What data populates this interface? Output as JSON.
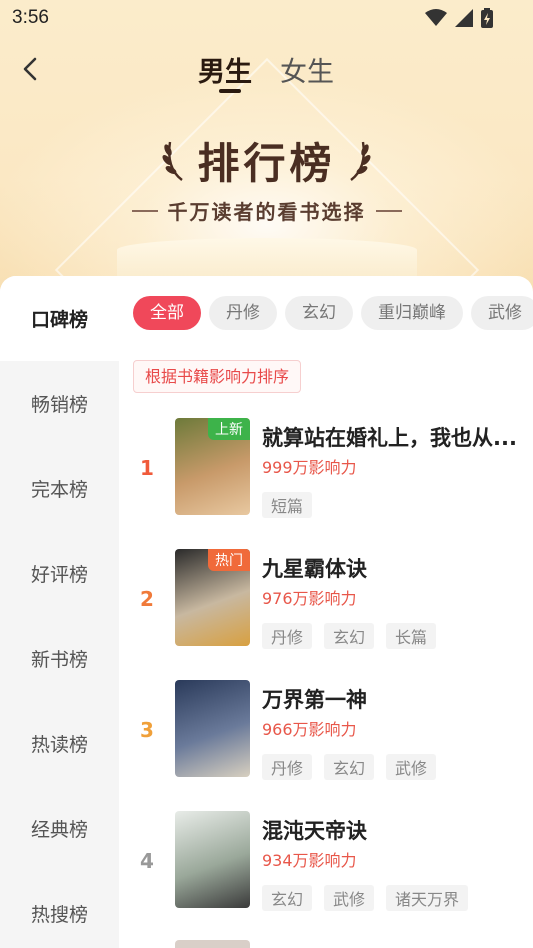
{
  "status_bar": {
    "time": "3:56"
  },
  "header": {
    "back_icon": "chevron-left-icon",
    "tabs": [
      {
        "label": "男生",
        "active": true
      },
      {
        "label": "女生",
        "active": false
      }
    ]
  },
  "hero": {
    "title": "排行榜",
    "subtitle": "千万读者的看书选择"
  },
  "sidebar": {
    "items": [
      {
        "label": "口碑榜",
        "active": true
      },
      {
        "label": "畅销榜",
        "active": false
      },
      {
        "label": "完本榜",
        "active": false
      },
      {
        "label": "好评榜",
        "active": false
      },
      {
        "label": "新书榜",
        "active": false
      },
      {
        "label": "热读榜",
        "active": false
      },
      {
        "label": "经典榜",
        "active": false
      },
      {
        "label": "热搜榜",
        "active": false
      }
    ]
  },
  "filters": {
    "chips": [
      {
        "label": "全部",
        "active": true
      },
      {
        "label": "丹修",
        "active": false
      },
      {
        "label": "玄幻",
        "active": false
      },
      {
        "label": "重归巅峰",
        "active": false
      },
      {
        "label": "武修",
        "active": false
      }
    ]
  },
  "sort_note": "根据书籍影响力排序",
  "books": [
    {
      "rank": "1",
      "rank_color": "#f05a3a",
      "title": "就算站在婚礼上，我也从...",
      "heat": "999万影响力",
      "badge": "上新",
      "badge_color": "#3db34a",
      "tags": [
        "短篇"
      ],
      "cover_colors": [
        "#6d7a3a",
        "#c89a6a",
        "#e8c8a0"
      ]
    },
    {
      "rank": "2",
      "rank_color": "#f07a3a",
      "title": "九星霸体诀",
      "heat": "976万影响力",
      "badge": "热门",
      "badge_color": "#f06a3a",
      "tags": [
        "丹修",
        "玄幻",
        "长篇"
      ],
      "cover_colors": [
        "#2a2a2a",
        "#c8b8a0",
        "#d8a040"
      ]
    },
    {
      "rank": "3",
      "rank_color": "#f0a03a",
      "title": "万界第一神",
      "heat": "966万影响力",
      "badge": "",
      "badge_color": "",
      "tags": [
        "丹修",
        "玄幻",
        "武修"
      ],
      "cover_colors": [
        "#2a3a5a",
        "#6a7a9a",
        "#d8d0c0"
      ]
    },
    {
      "rank": "4",
      "rank_color": "#999999",
      "title": "混沌天帝诀",
      "heat": "934万影响力",
      "badge": "",
      "badge_color": "",
      "tags": [
        "玄幻",
        "武修",
        "诸天万界"
      ],
      "cover_colors": [
        "#e8ece8",
        "#9aa89a",
        "#3a3a3a"
      ]
    }
  ]
}
